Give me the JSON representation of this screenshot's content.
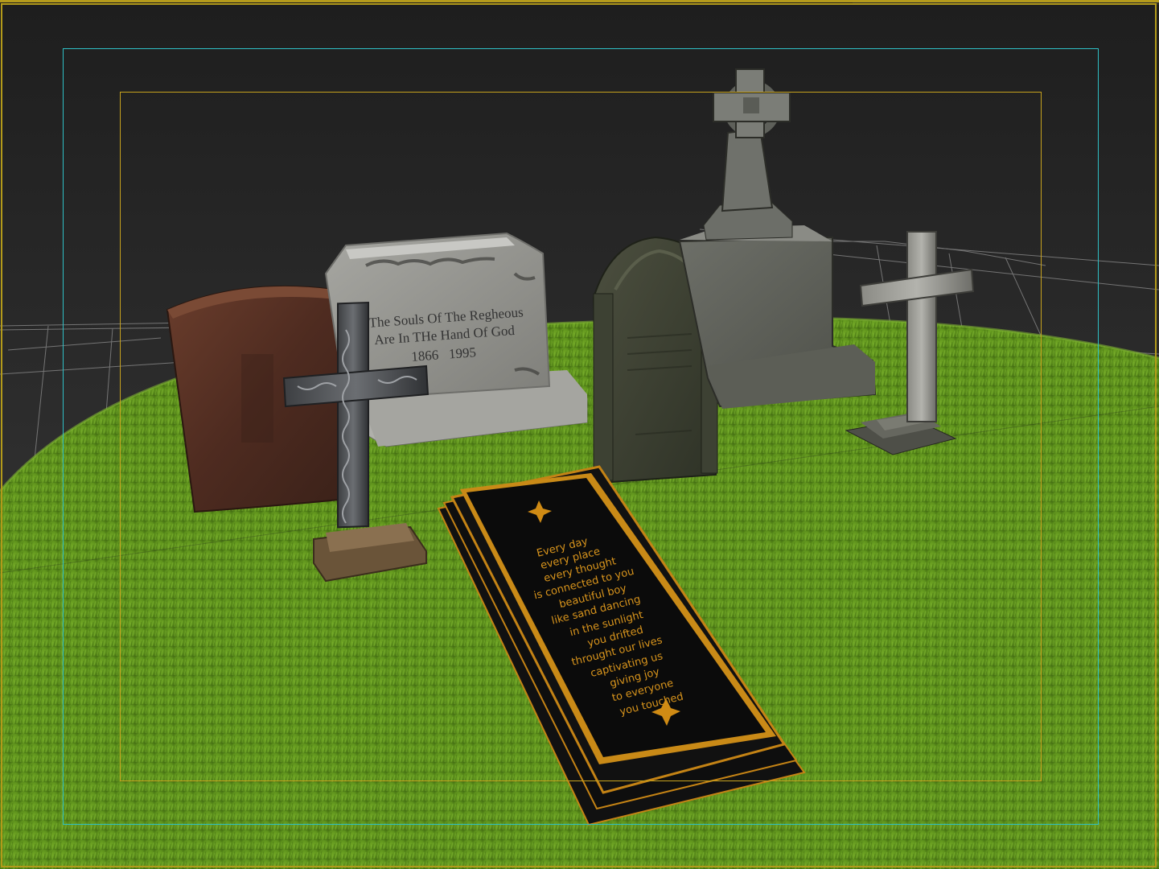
{
  "viewport": {
    "name": "3D Perspective Viewport",
    "background_top": "#1f1f1f",
    "background_bottom": "#3b3b3b",
    "grid_color": "#9a9a9a",
    "safe_frame_outer_color": "#2fbfc5",
    "safe_frame_inner_color": "#c7a21e",
    "border_color": "#b39a1a"
  },
  "ground": {
    "label": "grass-ground-plane",
    "color_light": "#7fb42a",
    "color_dark": "#4b7a17"
  },
  "headstone_center": {
    "line1": "The Souls Of The Regheous",
    "line2": "Are In THe Hand Of God",
    "dates": "1866   1995"
  },
  "ledger_stone": {
    "border_color": "#d08b14",
    "text_color": "#d8941c",
    "lines": [
      "Every day",
      "every place",
      "every thought",
      "is connected to you",
      "beautiful boy",
      "like sand dancing",
      "in the sunlight",
      "you drifted",
      "throught our lives",
      "captivating us",
      "giving joy",
      "to everyone",
      "you touched"
    ]
  }
}
